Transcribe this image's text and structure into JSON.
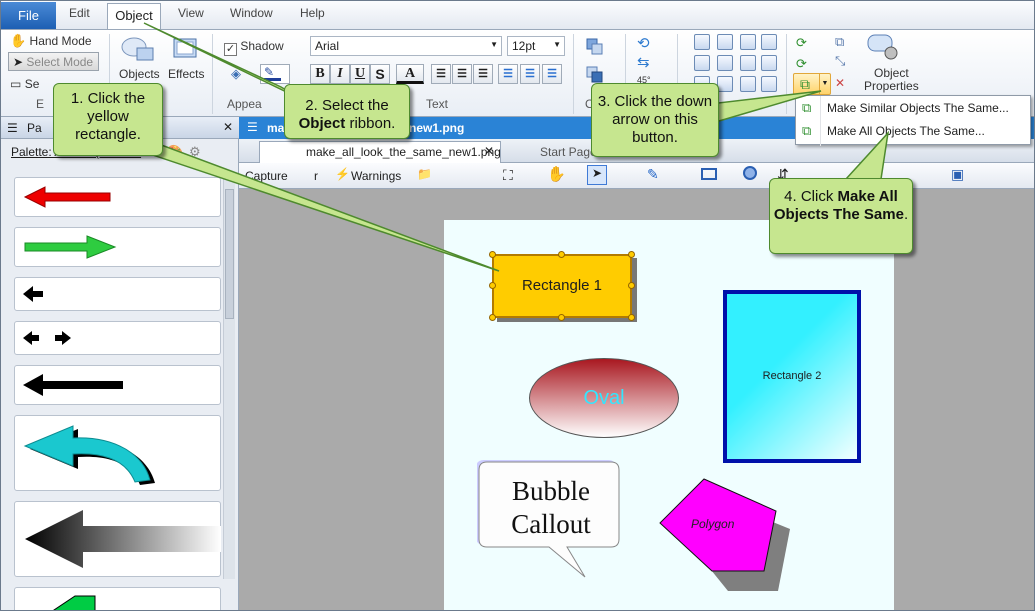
{
  "menu": {
    "file": "File",
    "edit": "Edit",
    "object": "Object",
    "view": "View",
    "window": "Window",
    "help": "Help"
  },
  "ribbon": {
    "hand_mode": "Hand Mode",
    "select_mode": "Select Mode",
    "select_short": "Se",
    "objects": "Objects",
    "effects": "Effects",
    "shadow": "Shadow",
    "font_name": "Arial",
    "font_size": "12pt",
    "group_appearance": "Appea",
    "group_text": "Text",
    "group_o": "O",
    "group_e": "E",
    "angle": "45°",
    "object_properties_line1": "Object",
    "object_properties_line2": "Properties",
    "bold": "B",
    "italic": "I",
    "underline": "U",
    "font_color": "A"
  },
  "dropdown": {
    "item1": "Make Similar Objects The Same...",
    "item2": "Make All Objects The Same..."
  },
  "palette": {
    "title": "Pa",
    "tab": "Palette: Arrows (Read ..."
  },
  "doctabs": {
    "active_top": "ma",
    "active_top_suffix": "new1.png",
    "tab1": "make_all_look_the_same_new1.png",
    "tab2": "Start Page"
  },
  "toolbar2": {
    "capture": "Capture",
    "capture_suffix": "r",
    "warnings": "Warnings"
  },
  "canvas": {
    "rect1": "Rectangle 1",
    "rect2": "Rectangle 2",
    "oval": "Oval",
    "bubble_line1": "Bubble",
    "bubble_line2": "Callout",
    "polygon": "Polygon"
  },
  "callouts": {
    "c1": "1. Click the yellow rectangle.",
    "c2_pre": "2. Select the",
    "c2_bold": "Object",
    "c2_post": "ribbon.",
    "c3": "3. Click the down arrow on this button.",
    "c4_pre": "4. Click",
    "c4_bold": "Make All Objects The Same",
    "c4_post": "."
  },
  "colors": {
    "callout_fill": "#c6e68f",
    "callout_border": "#4e8a2e",
    "accent": "#2a83d6",
    "yellow": "#ffcc00",
    "cyan": "#33f0ff",
    "magenta": "#ff00ff"
  }
}
